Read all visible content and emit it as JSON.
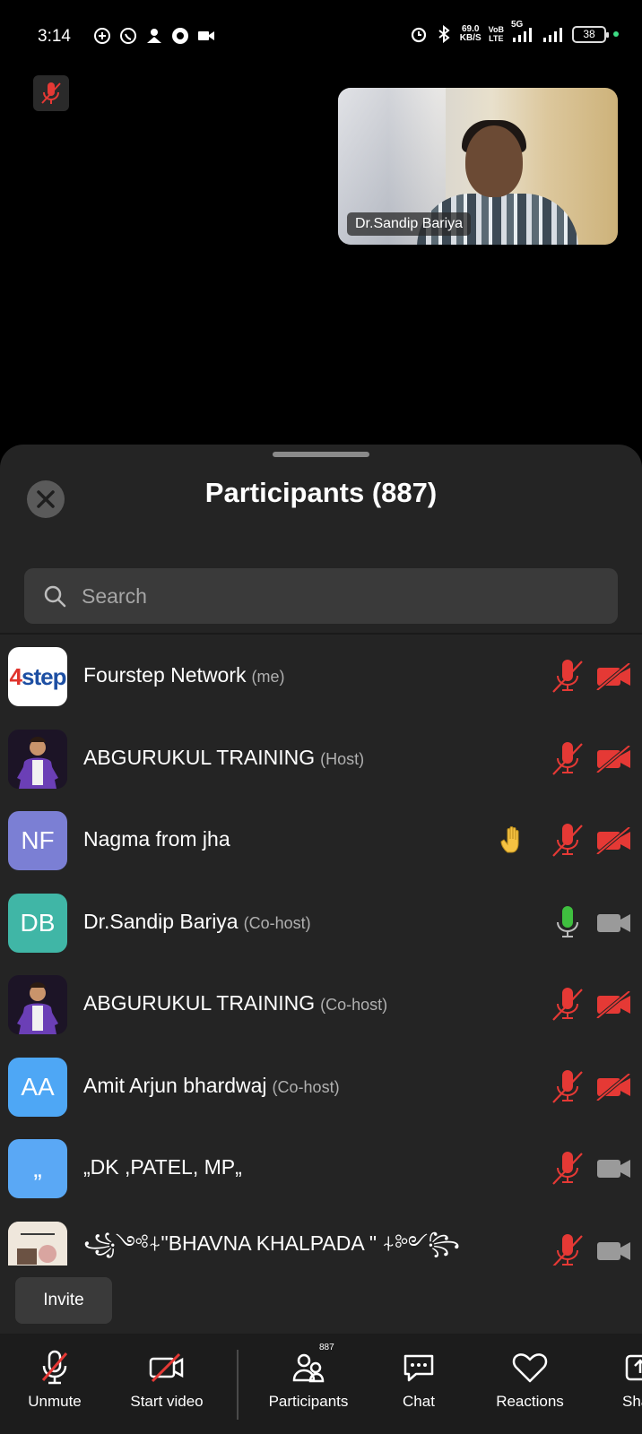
{
  "status_bar": {
    "time": "3:14",
    "speed_value": "69.0",
    "speed_unit": "KB/S",
    "network_vo": "VoB",
    "network_lte": "LTE",
    "network_5g": "5G",
    "battery": "38",
    "left_icons": [
      "whatsapp-plus-icon",
      "whatsapp-icon",
      "account-icon",
      "vpn-icon",
      "video-icon"
    ],
    "right_icons": [
      "alarm-icon",
      "bluetooth-icon",
      "signal-icon",
      "signal-icon-2"
    ]
  },
  "video": {
    "participant_name": "Dr.Sandip Bariya"
  },
  "participants_panel": {
    "title": "Participants (887)",
    "search_placeholder": "Search",
    "participants": [
      {
        "name": "Fourstep Network",
        "role": "(me)",
        "avatar_type": "logo",
        "avatar_text": "4step",
        "mic": "muted",
        "video": "off",
        "hand_raised": false
      },
      {
        "name": "ABGURUKUL TRAINING",
        "role": "(Host)",
        "avatar_type": "photo",
        "avatar_text": "",
        "mic": "muted",
        "video": "off",
        "hand_raised": false
      },
      {
        "name": "Nagma from jha",
        "role": "",
        "avatar_type": "initials",
        "avatar_text": "NF",
        "avatar_color": "#7b7fd4",
        "mic": "muted",
        "video": "off",
        "hand_raised": true
      },
      {
        "name": "Dr.Sandip Bariya",
        "role": "(Co-host)",
        "avatar_type": "initials",
        "avatar_text": "DB",
        "avatar_color": "#40b6a6",
        "mic": "active",
        "video": "on",
        "hand_raised": false
      },
      {
        "name": "ABGURUKUL TRAINING",
        "role": "(Co-host)",
        "avatar_type": "photo",
        "avatar_text": "",
        "mic": "muted",
        "video": "off",
        "hand_raised": false
      },
      {
        "name": "Amit Arjun bhardwaj",
        "role": "(Co-host)",
        "avatar_type": "initials",
        "avatar_text": "AA",
        "avatar_color": "#4ea7f5",
        "mic": "muted",
        "video": "off",
        "hand_raised": false
      },
      {
        "name": "„DK ,PATEL, MP„",
        "role": "",
        "avatar_type": "initials",
        "avatar_text": "„",
        "avatar_color": "#5aa8f5",
        "mic": "muted",
        "video": "off_grey",
        "hand_raised": false
      },
      {
        "name": "꧁༺⍭\"BHAVNA KHALPADA \" ⍭༻꧂",
        "role": "",
        "avatar_type": "photo-light",
        "avatar_text": "",
        "mic": "muted",
        "video": "off_grey",
        "hand_raised": false
      }
    ],
    "invite_label": "Invite"
  },
  "toolbar": {
    "unmute_label": "Unmute",
    "start_video_label": "Start video",
    "participants_label": "Participants",
    "participants_count": "887",
    "chat_label": "Chat",
    "reactions_label": "Reactions",
    "share_label": "Sha"
  },
  "colors": {
    "sheet_bg": "#242424",
    "muted_red": "#e53935",
    "mic_green": "#3fbf3f",
    "cam_grey": "#9a9a9a"
  }
}
